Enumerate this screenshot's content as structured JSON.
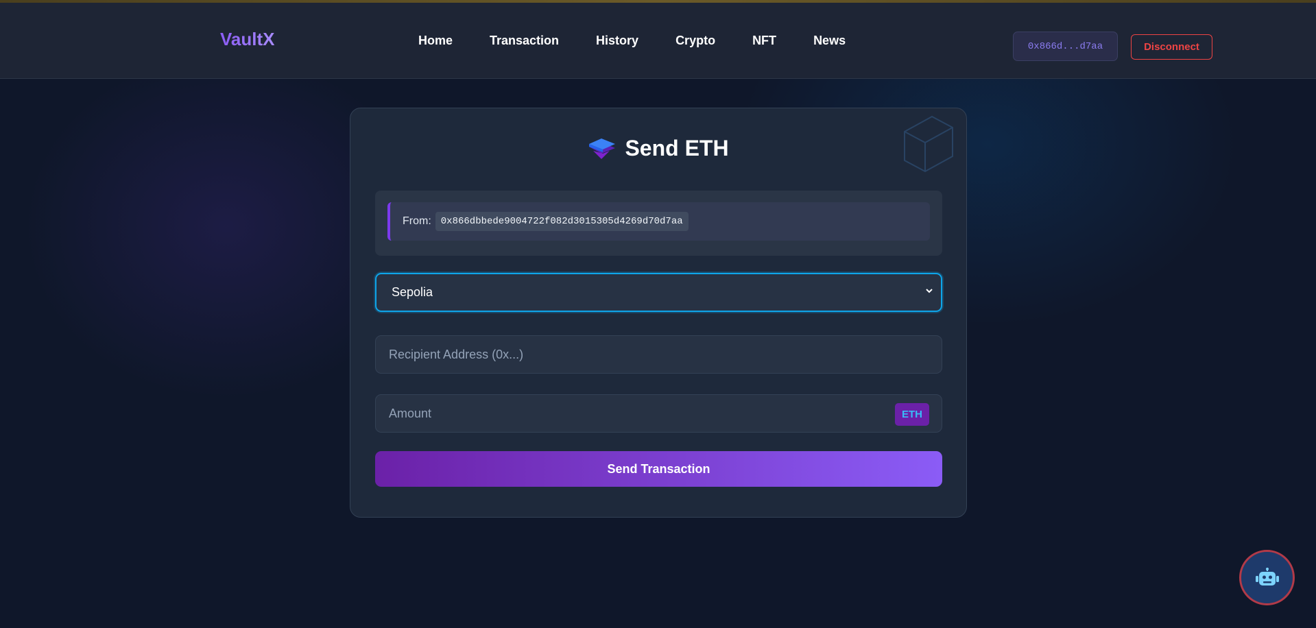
{
  "colors": {
    "brand": "#8b5cf6",
    "accent_blue": "#0ea5e9",
    "danger": "#ef4444",
    "background": "#0f172a",
    "card": "#1e293b"
  },
  "header": {
    "brand": "VaultX",
    "nav": [
      "Home",
      "Transaction",
      "History",
      "Crypto",
      "NFT",
      "News"
    ],
    "wallet_short": "0x866d...d7aa",
    "disconnect_label": "Disconnect"
  },
  "send_form": {
    "title_icon": "stacked-layers-icon",
    "title": "Send ETH",
    "from_label": "From:",
    "from_address": "0x866dbbede9004722f082d3015305d4269d70d7aa",
    "network_selected": "Sepolia",
    "recipient_placeholder": "Recipient Address (0x...)",
    "recipient_value": "",
    "amount_placeholder": "Amount",
    "amount_value": "",
    "amount_unit": "ETH",
    "submit_label": "Send Transaction"
  },
  "assistant": {
    "icon": "robot-icon"
  }
}
